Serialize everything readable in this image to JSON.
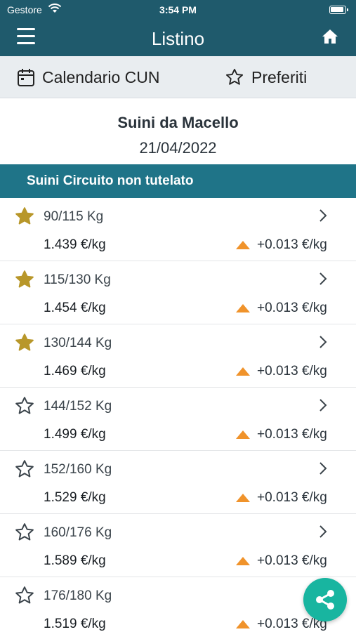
{
  "status_bar": {
    "carrier": "Gestore",
    "time": "3:54 PM"
  },
  "header": {
    "title": "Listino"
  },
  "tabs": {
    "calendar_label": "Calendario CUN",
    "favorites_label": "Preferiti"
  },
  "market": {
    "title": "Suini da Macello",
    "date": "21/04/2022"
  },
  "section": {
    "title": "Suini Circuito non tutelato"
  },
  "colors": {
    "header": "#1f5a6c",
    "section": "#1f7488",
    "star_filled": "#b8972a",
    "arrow_up": "#f0932b",
    "fab": "#18b5a0"
  },
  "items": [
    {
      "weight": "90/115 Kg",
      "price": "1.439 €/kg",
      "change": "+0.013 €/kg",
      "favorite": true
    },
    {
      "weight": "115/130 Kg",
      "price": "1.454 €/kg",
      "change": "+0.013 €/kg",
      "favorite": true
    },
    {
      "weight": "130/144 Kg",
      "price": "1.469 €/kg",
      "change": "+0.013 €/kg",
      "favorite": true
    },
    {
      "weight": "144/152 Kg",
      "price": "1.499 €/kg",
      "change": "+0.013 €/kg",
      "favorite": false
    },
    {
      "weight": "152/160 Kg",
      "price": "1.529 €/kg",
      "change": "+0.013 €/kg",
      "favorite": false
    },
    {
      "weight": "160/176 Kg",
      "price": "1.589 €/kg",
      "change": "+0.013 €/kg",
      "favorite": false
    },
    {
      "weight": "176/180 Kg",
      "price": "1.519 €/kg",
      "change": "+0.013 €/kg",
      "favorite": false
    }
  ],
  "icons": [
    "menu-icon",
    "home-icon",
    "calendar-icon",
    "star-icon",
    "chevron-right-icon",
    "arrow-up-icon",
    "share-icon"
  ]
}
